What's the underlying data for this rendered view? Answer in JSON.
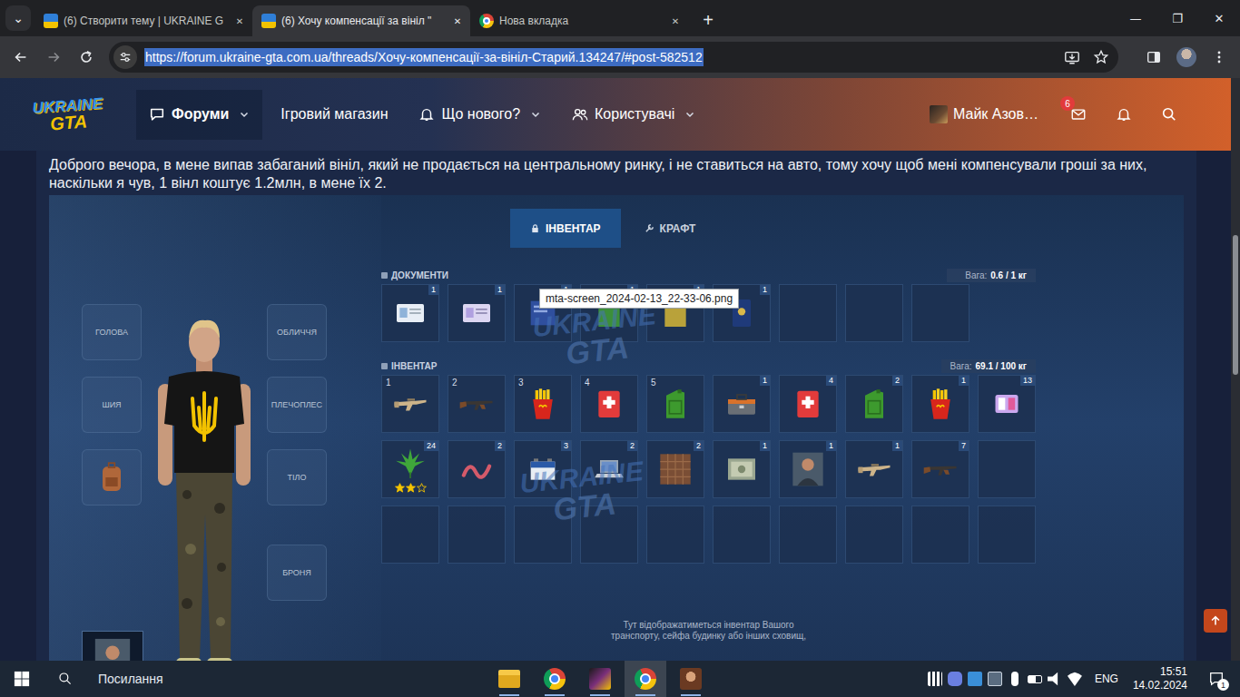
{
  "browser": {
    "tab_search": "⌄",
    "tabs": [
      {
        "title": "(6) Створити тему | UKRAINE G",
        "favicon": "site",
        "selected": false,
        "close": "✕"
      },
      {
        "title": "(6) Хочу компенсації за вініл \"",
        "favicon": "site",
        "selected": true,
        "close": "✕"
      },
      {
        "title": "Нова вкладка",
        "favicon": "chrome",
        "selected": false,
        "close": "✕"
      }
    ],
    "new_tab": "+",
    "window_controls": [
      "—",
      "❐",
      "✕"
    ],
    "url": "https://forum.ukraine-gta.com.ua/threads/Хочу-компенсації-за-вініл-Старий.134247/#post-582512",
    "url_selected": true
  },
  "forum": {
    "logo": [
      "UKRAINE",
      "GTA"
    ],
    "nav": [
      {
        "label": "Форуми",
        "kind": "chat",
        "chevron": true,
        "selected": true
      },
      {
        "label": "Ігровий магазин",
        "kind": "none",
        "chevron": false,
        "selected": false
      },
      {
        "label": "Що нового?",
        "kind": "bell",
        "chevron": true,
        "selected": false
      },
      {
        "label": "Користувачі",
        "kind": "users",
        "chevron": true,
        "selected": false
      }
    ],
    "user": {
      "name": "Майк Азов…",
      "mail_badge": "6"
    },
    "post_text": "Доброго вечора, в мене випав забаганий вініл, який не продається на центральному ринку, і не ставиться на авто, тому хочу щоб мені компенсували гроші за них, наскільки я чув, 1 вінл коштує 1.2млн, в мене їх 2.",
    "scrollbar": {
      "thumb_start": 0.27,
      "thumb_size": 0.24
    }
  },
  "game": {
    "tabs": [
      {
        "label": "ІНВЕНТАР",
        "kind": "lock",
        "selected": true
      },
      {
        "label": "КРАФТ",
        "kind": "wrench",
        "selected": false
      }
    ],
    "equipment_left": [
      {
        "label": "ГОЛОВА",
        "kind": "empty"
      },
      {
        "label": "ШИЯ",
        "kind": "empty"
      },
      {
        "kind": "backpack"
      }
    ],
    "equipment_right": [
      {
        "label": "ОБЛИЧЧЯ",
        "kind": "empty"
      },
      {
        "label": "ПЛЕЧОПЛЕС",
        "kind": "empty"
      },
      {
        "label": "ТІЛО",
        "kind": "empty"
      },
      {
        "label": "БРОНЯ",
        "kind": "empty"
      }
    ],
    "documents": {
      "title": "ДОКУМЕНТИ",
      "weight_label": "Вага:",
      "weight_value": "0.6 / 1 кг",
      "slots": [
        {
          "kind": "license",
          "count": "1"
        },
        {
          "kind": "card",
          "count": "1"
        },
        {
          "kind": "doc-blue",
          "count": "1"
        },
        {
          "kind": "doc-green",
          "count": "1"
        },
        {
          "kind": "doc-yellow",
          "count": "1"
        },
        {
          "kind": "passport",
          "count": "1"
        },
        {
          "kind": "empty"
        },
        {
          "kind": "empty"
        },
        {
          "kind": "empty"
        }
      ]
    },
    "inventory": {
      "title": "ІНВЕНТАР",
      "weight_label": "Вага:",
      "weight_value": "69.1 / 100 кг",
      "slots": [
        {
          "kind": "rifle",
          "hotkey": "1"
        },
        {
          "kind": "ak",
          "hotkey": "2"
        },
        {
          "kind": "fries",
          "hotkey": "3"
        },
        {
          "kind": "medkit",
          "hotkey": "4"
        },
        {
          "kind": "canister",
          "hotkey": "5"
        },
        {
          "kind": "toolbox",
          "count": "1"
        },
        {
          "kind": "medkit",
          "count": "4"
        },
        {
          "kind": "canister",
          "count": "2"
        },
        {
          "kind": "fries",
          "count": "1"
        },
        {
          "kind": "cards",
          "count": "13"
        },
        {
          "kind": "weed",
          "count": "24",
          "stars": 2,
          "stars_max": 3
        },
        {
          "kind": "worm",
          "count": "2"
        },
        {
          "kind": "battery",
          "count": "3"
        },
        {
          "kind": "laptop",
          "count": "2"
        },
        {
          "kind": "bag",
          "count": "2"
        },
        {
          "kind": "money",
          "count": "1"
        },
        {
          "kind": "photo",
          "count": "1"
        },
        {
          "kind": "rifle",
          "count": "1"
        },
        {
          "kind": "ak",
          "count": "7"
        },
        {
          "kind": "empty"
        },
        {
          "kind": "empty"
        },
        {
          "kind": "empty"
        },
        {
          "kind": "empty"
        },
        {
          "kind": "empty"
        },
        {
          "kind": "empty"
        },
        {
          "kind": "empty"
        },
        {
          "kind": "empty"
        },
        {
          "kind": "empty"
        },
        {
          "kind": "empty"
        },
        {
          "kind": "empty"
        }
      ]
    },
    "hint": [
      "Тут відображатиметься інвентар Вашого",
      "транспорту, сейфа будинку або інших сховищ,"
    ],
    "watermarks": [
      [
        "UKRAINE",
        "GTA"
      ],
      [
        "UKRAINE",
        "GTA"
      ]
    ]
  },
  "tooltip": "mta-screen_2024-02-13_22-33-06.png",
  "taskbar": {
    "search": "Посилання",
    "apps": [
      {
        "kind": "explorer",
        "selected": false
      },
      {
        "kind": "chrome",
        "selected": false
      },
      {
        "kind": "game",
        "selected": false
      },
      {
        "kind": "chrome",
        "selected": true
      },
      {
        "kind": "avatar",
        "selected": false
      }
    ],
    "tray": [
      {
        "kind": "grid"
      },
      {
        "kind": "discord"
      },
      {
        "kind": "app-blue"
      },
      {
        "kind": "app-net"
      },
      {
        "kind": "mic"
      },
      {
        "kind": "battery"
      },
      {
        "kind": "volume"
      },
      {
        "kind": "network"
      }
    ],
    "lang": "ENG",
    "time": "15:51",
    "date": "14.02.2024",
    "notifications": "1"
  }
}
